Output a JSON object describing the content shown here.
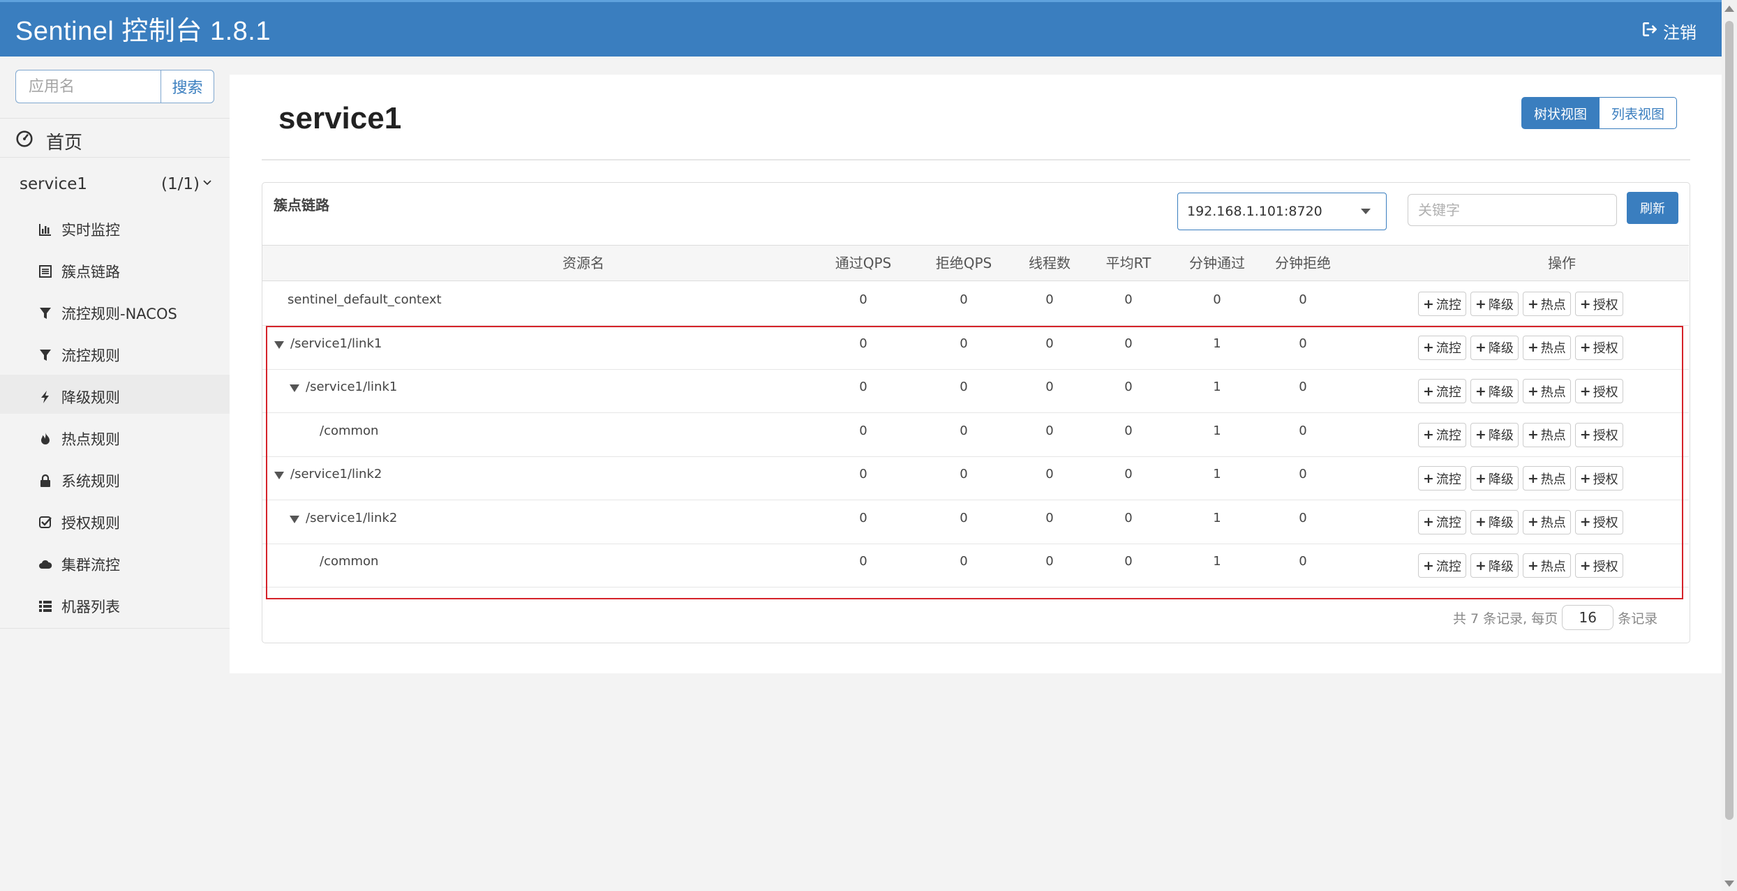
{
  "header": {
    "brand": "Sentinel 控制台 1.8.1",
    "logout_label": "注销"
  },
  "sidebar": {
    "search_placeholder": "应用名",
    "search_button": "搜索",
    "home_label": "首页",
    "app": {
      "name": "service1",
      "count": "(1/1)"
    },
    "menu": [
      {
        "label": "实时监控",
        "icon": "bar-chart-icon"
      },
      {
        "label": "簇点链路",
        "icon": "list-alt-icon"
      },
      {
        "label": "流控规则-NACOS",
        "icon": "filter-icon"
      },
      {
        "label": "流控规则",
        "icon": "filter-icon"
      },
      {
        "label": "降级规则",
        "icon": "flash-icon"
      },
      {
        "label": "热点规则",
        "icon": "fire-icon"
      },
      {
        "label": "系统规则",
        "icon": "lock-icon"
      },
      {
        "label": "授权规则",
        "icon": "check-icon"
      },
      {
        "label": "集群流控",
        "icon": "cloud-icon"
      },
      {
        "label": "机器列表",
        "icon": "th-list-icon"
      }
    ]
  },
  "main": {
    "title": "service1",
    "view_tree": "树状视图",
    "view_list": "列表视图",
    "panel_title": "簇点链路",
    "machine_selected": "192.168.1.101:8720",
    "keyword_placeholder": "关键字",
    "refresh_label": "刷新",
    "columns": [
      "资源名",
      "通过QPS",
      "拒绝QPS",
      "线程数",
      "平均RT",
      "分钟通过",
      "分钟拒绝",
      "操作"
    ],
    "op_labels": [
      "流控",
      "降级",
      "热点",
      "授权"
    ],
    "rows": [
      {
        "name": "sentinel_default_context",
        "level": 0,
        "expandable": false,
        "pass_qps": "0",
        "block_qps": "0",
        "threads": "0",
        "avg_rt": "0",
        "min_pass": "0",
        "min_block": "0"
      },
      {
        "name": "/service1/link1",
        "level": 0,
        "expandable": true,
        "pass_qps": "0",
        "block_qps": "0",
        "threads": "0",
        "avg_rt": "0",
        "min_pass": "1",
        "min_block": "0"
      },
      {
        "name": "/service1/link1",
        "level": 1,
        "expandable": true,
        "pass_qps": "0",
        "block_qps": "0",
        "threads": "0",
        "avg_rt": "0",
        "min_pass": "1",
        "min_block": "0"
      },
      {
        "name": "/common",
        "level": 2,
        "expandable": false,
        "pass_qps": "0",
        "block_qps": "0",
        "threads": "0",
        "avg_rt": "0",
        "min_pass": "1",
        "min_block": "0"
      },
      {
        "name": "/service1/link2",
        "level": 0,
        "expandable": true,
        "pass_qps": "0",
        "block_qps": "0",
        "threads": "0",
        "avg_rt": "0",
        "min_pass": "1",
        "min_block": "0"
      },
      {
        "name": "/service1/link2",
        "level": 1,
        "expandable": true,
        "pass_qps": "0",
        "block_qps": "0",
        "threads": "0",
        "avg_rt": "0",
        "min_pass": "1",
        "min_block": "0"
      },
      {
        "name": "/common",
        "level": 2,
        "expandable": false,
        "pass_qps": "0",
        "block_qps": "0",
        "threads": "0",
        "avg_rt": "0",
        "min_pass": "1",
        "min_block": "0"
      }
    ],
    "pager": {
      "prefix": "共 7 条记录, 每页",
      "page_size": "16",
      "suffix": "条记录"
    }
  },
  "colors": {
    "brand_blue": "#3a7ebf",
    "highlight_red": "#d5232a"
  }
}
